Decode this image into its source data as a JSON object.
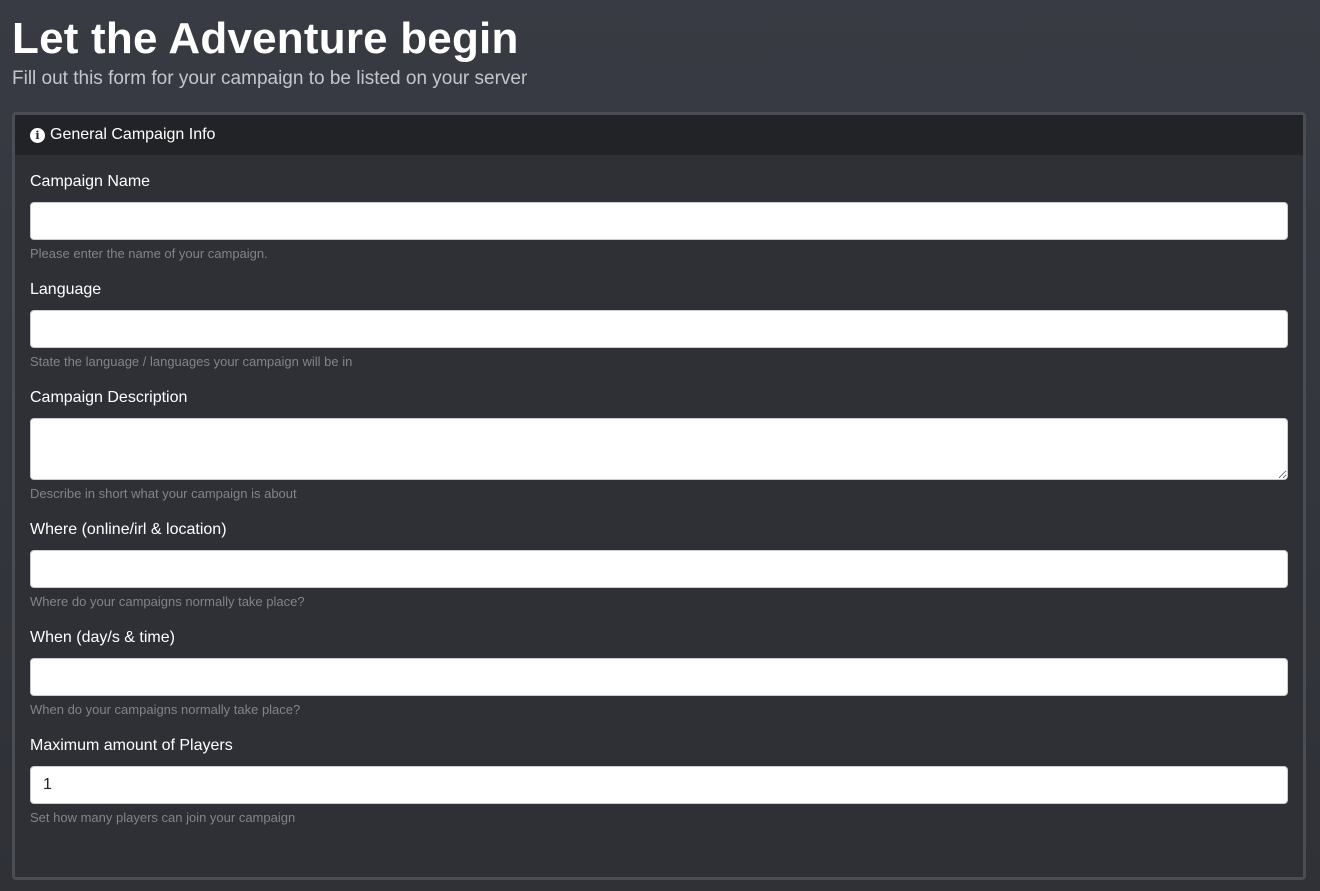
{
  "page": {
    "title": "Let the Adventure begin",
    "subtitle": "Fill out this form for your campaign to be listed on your server"
  },
  "card": {
    "header_icon": "info-circle-icon",
    "header_title": "General Campaign Info"
  },
  "fields": {
    "campaign_name": {
      "label": "Campaign Name",
      "value": "",
      "help": "Please enter the name of your campaign."
    },
    "language": {
      "label": "Language",
      "value": "",
      "help": "State the language / languages your campaign will be in"
    },
    "description": {
      "label": "Campaign Description",
      "value": "",
      "help": "Describe in short what your campaign is about"
    },
    "where": {
      "label": "Where (online/irl & location)",
      "value": "",
      "help": "Where do your campaigns normally take place?"
    },
    "when": {
      "label": "When (day/s & time)",
      "value": "",
      "help": "When do your campaigns normally take place?"
    },
    "max_players": {
      "label": "Maximum amount of Players",
      "value": "1",
      "help": "Set how many players can join your campaign"
    }
  },
  "colors": {
    "background": "#383b43",
    "card_background": "#2e3036",
    "card_header": "#222327",
    "help_text": "#80848c"
  }
}
